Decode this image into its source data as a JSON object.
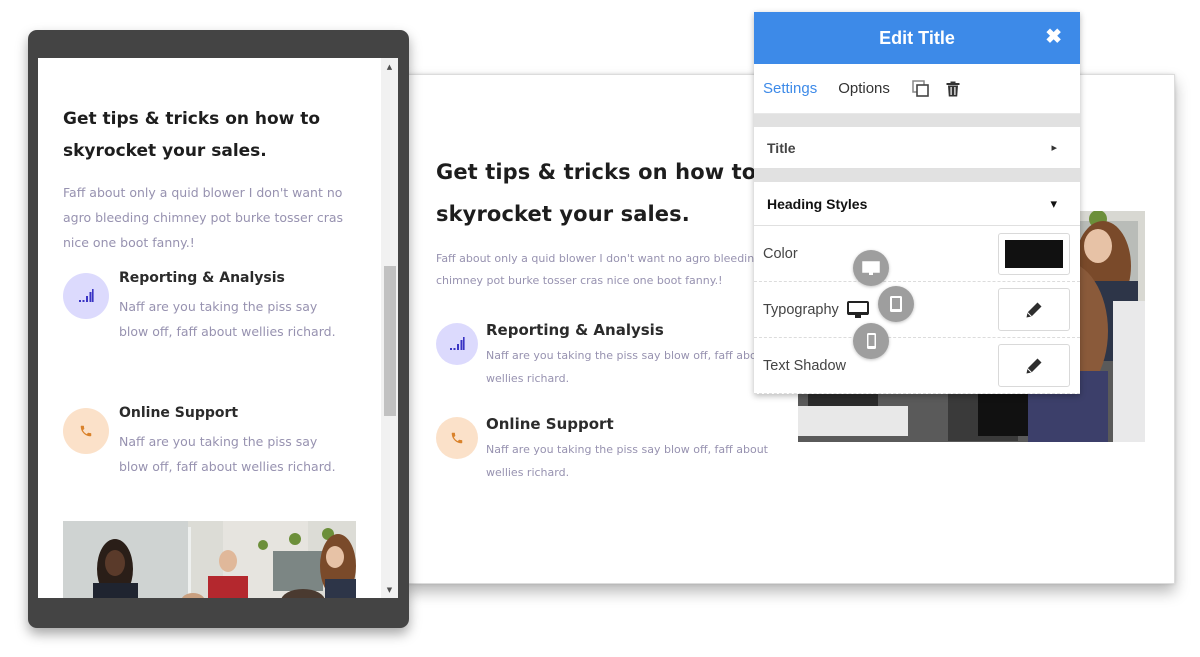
{
  "mobile_preview": {
    "heading": "Get tips & tricks on how to skyrocket your sales.",
    "description": "Faff about only a quid blower I don't want no agro bleeding chimney pot burke tosser cras nice one boot fanny.!",
    "features": [
      {
        "icon": "signal-bars-icon",
        "title": "Reporting & Analysis",
        "text": "Naff are you taking the piss say blow off, faff about wellies richard."
      },
      {
        "icon": "phone-icon",
        "title": "Online Support",
        "text": "Naff are you taking the piss say blow off, faff about wellies richard."
      }
    ],
    "image_alt": "team-meeting-photo",
    "scrollbar": {
      "up_arrow": "▲",
      "down_arrow": "▼"
    }
  },
  "desktop_preview": {
    "heading": "Get tips & tricks on how to skyrocket your sales.",
    "description": "Faff about only a quid blower I don't want no agro bleeding chimney pot burke tosser cras nice one boot fanny.!",
    "features": [
      {
        "icon": "signal-bars-icon",
        "title": "Reporting & Analysis",
        "text": "Naff are you taking the piss say blow off, faff about wellies richard."
      },
      {
        "icon": "phone-icon",
        "title": "Online Support",
        "text": "Naff are you taking the piss say blow off, faff about wellies richard."
      }
    ],
    "image_alt": "team-meeting-photo"
  },
  "edit_panel": {
    "title": "Edit Title",
    "close_icon": "✖",
    "tabs": [
      {
        "label": "Settings",
        "active": true
      },
      {
        "label": "Options",
        "active": false
      }
    ],
    "tools": [
      "copy-icon",
      "trash-icon"
    ],
    "sections": [
      {
        "label": "Title",
        "state": "collapsed",
        "indicator": "▸"
      },
      {
        "label": "Heading Styles",
        "state": "expanded",
        "indicator": "▾"
      }
    ],
    "rows": [
      {
        "label": "Color",
        "control": "color-swatch",
        "value": "#111111"
      },
      {
        "label": "Typography",
        "control": "edit-button",
        "responsive_icon": "desktop-icon"
      },
      {
        "label": "Text Shadow",
        "control": "edit-button"
      }
    ],
    "device_options": [
      "desktop",
      "tablet",
      "mobile"
    ]
  },
  "colors": {
    "accent_blue": "#3d8ae8",
    "frame_dark": "#444444",
    "body_text": "#9792b0",
    "heading_text": "#1d1d1d",
    "icon_bg_purple": "#dcdafd",
    "icon_fg_purple": "#3a34c4",
    "icon_bg_peach": "#fbe1c9",
    "icon_fg_peach": "#d9822b"
  }
}
